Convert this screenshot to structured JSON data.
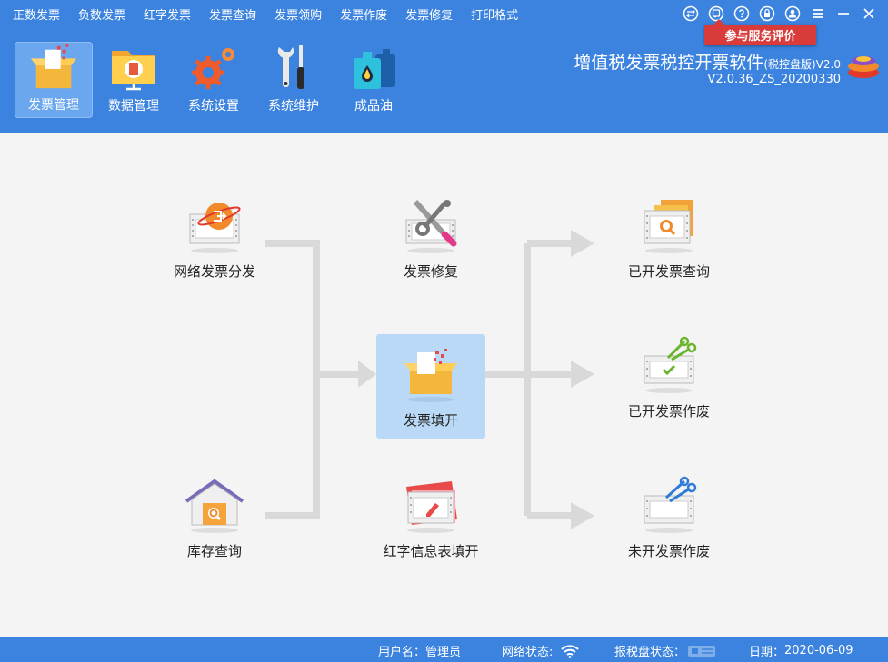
{
  "menu": [
    "正数发票",
    "负数发票",
    "红字发票",
    "发票查询",
    "发票领购",
    "发票作废",
    "发票修复",
    "打印格式"
  ],
  "service_tag": "参与服务评价",
  "toolbar": [
    {
      "label": "发票管理",
      "icon": "invoice-box-icon",
      "active": true
    },
    {
      "label": "数据管理",
      "icon": "data-folder-icon"
    },
    {
      "label": "系统设置",
      "icon": "gears-icon"
    },
    {
      "label": "系统维护",
      "icon": "tools-icon"
    },
    {
      "label": "成品油",
      "icon": "oil-can-icon"
    }
  ],
  "app": {
    "title": "增值税发票税控开票软件",
    "edition": "(税控盘版)",
    "title_suffix": "V2.0",
    "version": "V2.0.36_ZS_20200330"
  },
  "nodes": {
    "network": "网络发票分发",
    "repair": "发票修复",
    "issued_query": "已开发票查询",
    "fill": "发票填开",
    "issued_void": "已开发票作废",
    "inventory": "库存查询",
    "red_info": "红字信息表填开",
    "blank_void": "未开发票作废"
  },
  "status": {
    "user_label": "用户名：",
    "user_value": "管理员",
    "network_label": "网络状态:",
    "taxdisk_label": "报税盘状态：",
    "date_label": "日期：",
    "date_value": "2020-06-09"
  },
  "colors": {
    "header": "#3b83de",
    "flow_line": "#d9d9d9",
    "center_bg": "#b9d9f6",
    "service_tag": "#d93a3a"
  }
}
